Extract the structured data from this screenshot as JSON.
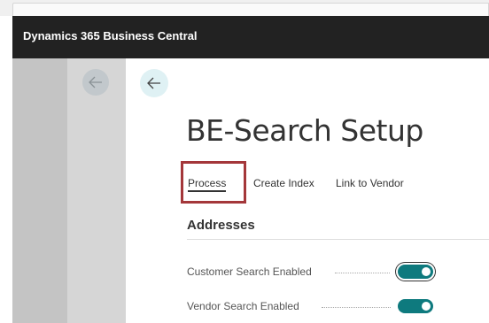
{
  "app": {
    "title": "Dynamics 365 Business Central"
  },
  "page": {
    "title": "BE-Search Setup"
  },
  "actions": [
    {
      "label": "Process"
    },
    {
      "label": "Create Index"
    },
    {
      "label": "Link to Vendor"
    }
  ],
  "section": {
    "title": "Addresses"
  },
  "fields": [
    {
      "label": "Customer Search Enabled",
      "value": true
    },
    {
      "label": "Vendor Search Enabled",
      "value": true
    }
  ],
  "icons": [
    "back-arrow-icon",
    "back-arrow-icon"
  ],
  "colors": {
    "appbar": "#222222",
    "toggle_on": "#0e7a7e",
    "highlight": "#a4373a"
  }
}
